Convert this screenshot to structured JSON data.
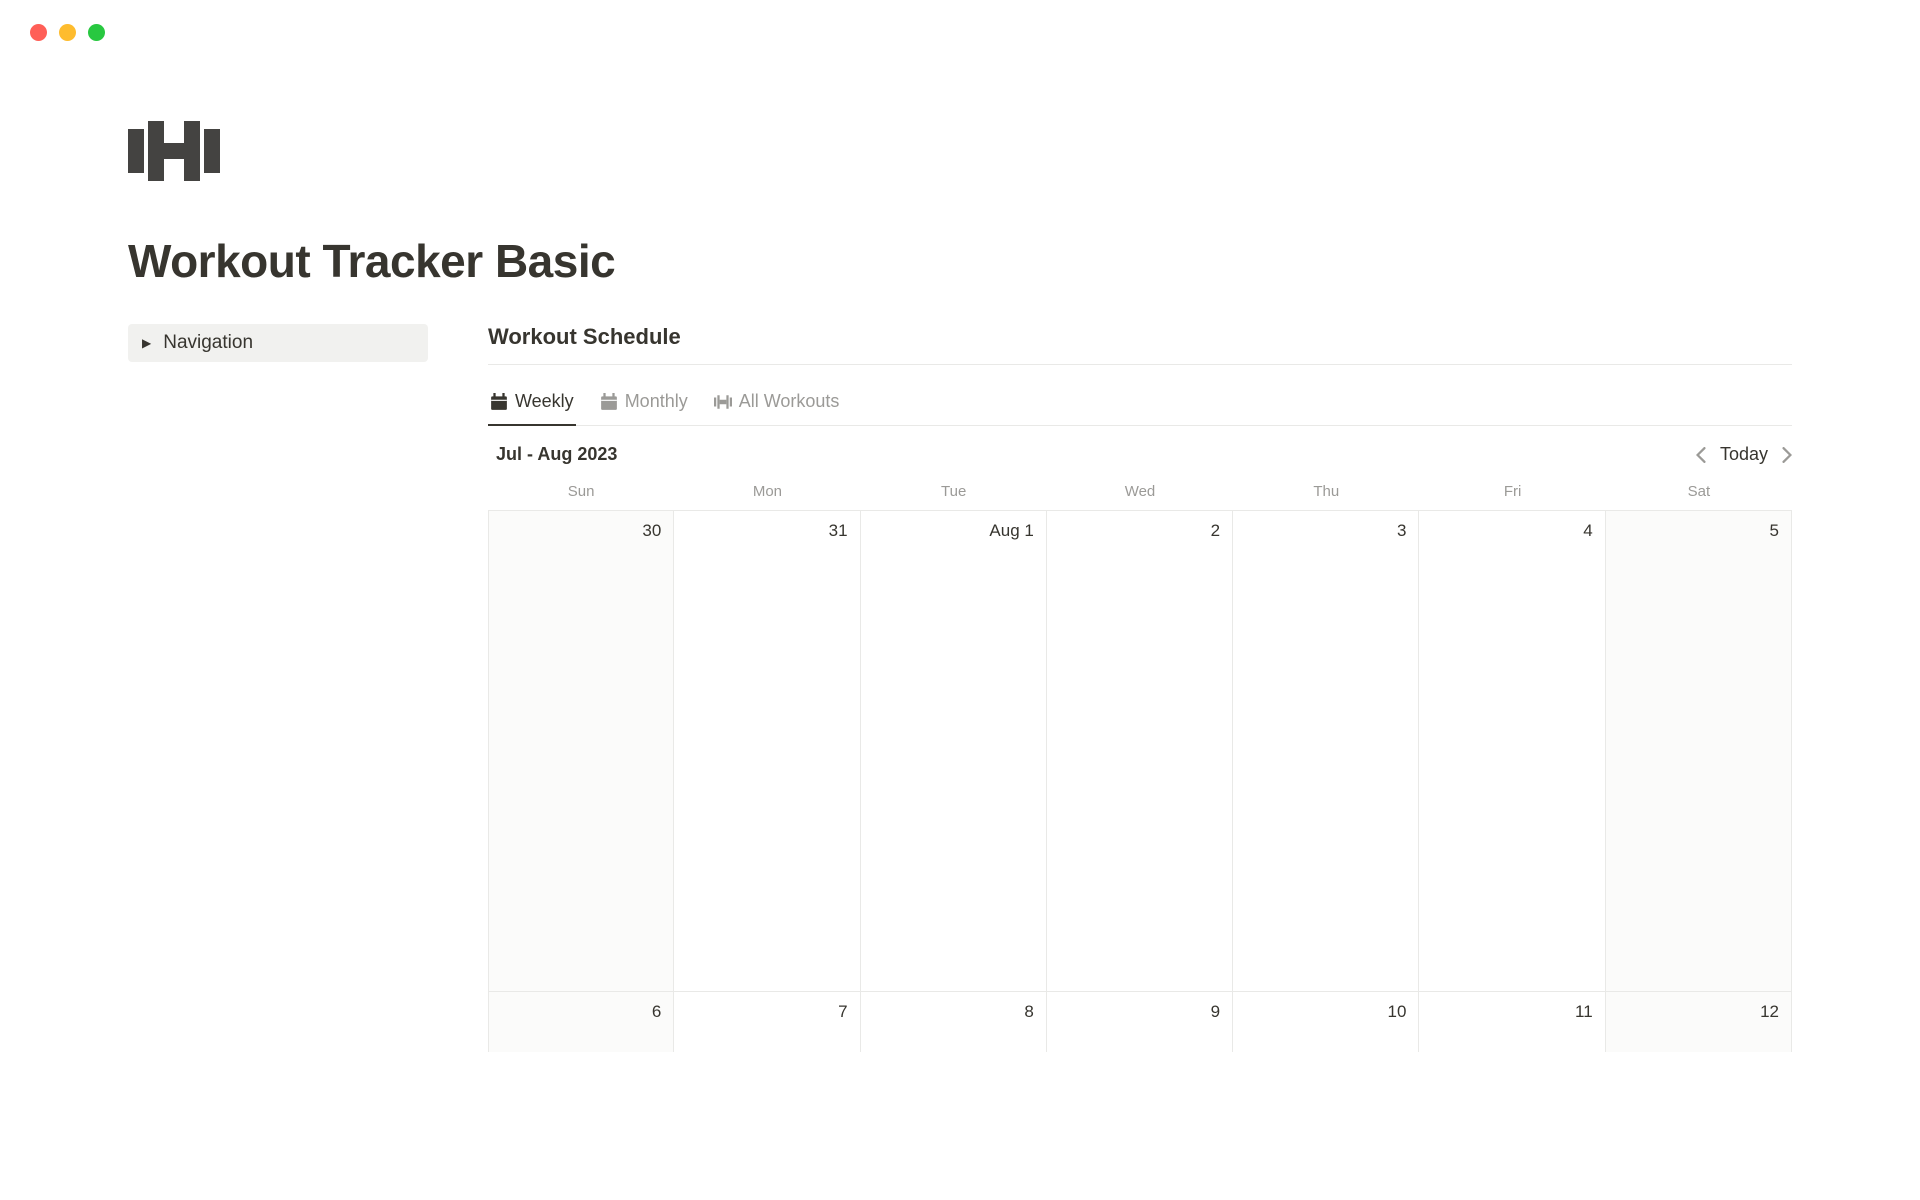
{
  "page": {
    "title": "Workout Tracker Basic"
  },
  "sidebar": {
    "nav_label": "Navigation"
  },
  "schedule": {
    "title": "Workout Schedule",
    "tabs": [
      {
        "label": "Weekly"
      },
      {
        "label": "Monthly"
      },
      {
        "label": "All Workouts"
      }
    ],
    "date_range": "Jul - Aug 2023",
    "today_label": "Today",
    "day_names": [
      "Sun",
      "Mon",
      "Tue",
      "Wed",
      "Thu",
      "Fri",
      "Sat"
    ],
    "weeks": [
      [
        "30",
        "31",
        "Aug 1",
        "2",
        "3",
        "4",
        "5"
      ],
      [
        "6",
        "7",
        "8",
        "9",
        "10",
        "11",
        "12"
      ]
    ]
  }
}
